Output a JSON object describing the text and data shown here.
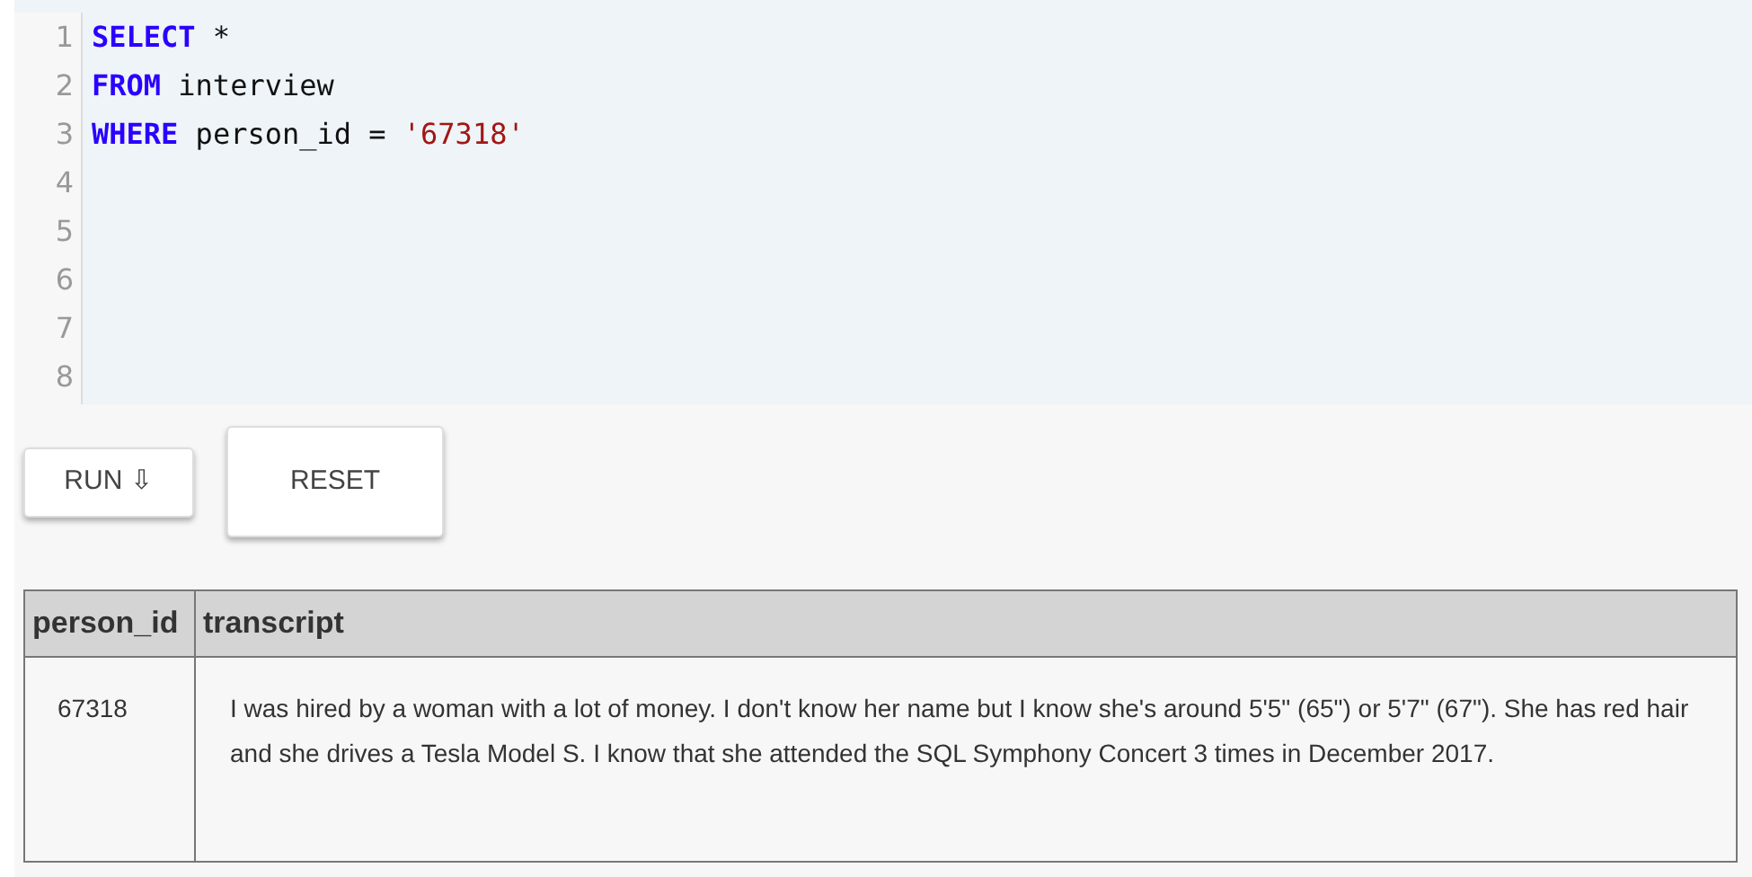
{
  "editor": {
    "lines": [
      {
        "number": "1",
        "tokens": [
          {
            "kind": "keyword",
            "text": "SELECT"
          },
          {
            "kind": "plain",
            "text": " *"
          }
        ]
      },
      {
        "number": "2",
        "tokens": [
          {
            "kind": "keyword",
            "text": "FROM"
          },
          {
            "kind": "plain",
            "text": " interview"
          }
        ]
      },
      {
        "number": "3",
        "tokens": [
          {
            "kind": "keyword",
            "text": "WHERE"
          },
          {
            "kind": "plain",
            "text": " person_id = "
          },
          {
            "kind": "string",
            "text": "'67318'"
          }
        ]
      },
      {
        "number": "4"
      },
      {
        "number": "5"
      },
      {
        "number": "6"
      },
      {
        "number": "7"
      },
      {
        "number": "8"
      }
    ]
  },
  "buttons": [
    {
      "label": "RUN ⇩",
      "kind": "run"
    },
    {
      "label": "RESET",
      "kind": "reset"
    }
  ],
  "table": {
    "columns": [
      "person_id",
      "transcript"
    ],
    "rows": [
      [
        "67318",
        "I was hired by a woman with a lot of money. I don't know her name but I know she's around 5'5\" (65\") or 5'7\" (67\"). She has red hair and she drives a Tesla Model S. I know that she attended the SQL Symphony Concert 3 times in December 2017."
      ]
    ]
  }
}
